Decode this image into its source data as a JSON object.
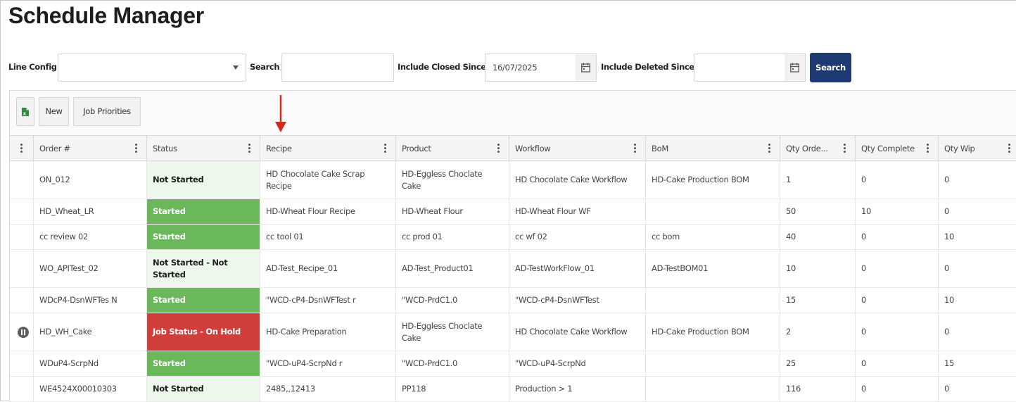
{
  "page": {
    "title": "Schedule Manager"
  },
  "filters": {
    "line_config_label": "Line Config",
    "line_config_value": "",
    "search_label": "Search",
    "search_value": "",
    "closed_since_label": "Include Closed Since",
    "closed_since_value": "16/07/2025",
    "deleted_since_label": "Include Deleted Since",
    "deleted_since_value": "",
    "search_button": "Search"
  },
  "toolbar": {
    "export_icon": "excel-export-icon",
    "new_label": "New",
    "priorities_label": "Job Priorities"
  },
  "columns": [
    "Order #",
    "Status",
    "Recipe",
    "Product",
    "Workflow",
    "BoM",
    "Qty Orde...",
    "Qty Complete",
    "Qty Wip"
  ],
  "rows": [
    {
      "order": "ON_012",
      "status": "Not Started",
      "recipe": "HD Chocolate Cake Scrap Recipe",
      "product": "HD-Eggless Choclate Cake",
      "workflow": "HD Chocolate Cake Workflow",
      "bom": "HD-Cake Production BOM",
      "qty_ordered": "1",
      "qty_complete": "0",
      "qty_wip": "0",
      "status_kind": "not-started",
      "icon": ""
    },
    {
      "order": "HD_Wheat_LR",
      "status": "Started",
      "recipe": "HD-Wheat Flour Recipe",
      "product": "HD-Wheat Flour",
      "workflow": "HD-Wheat Flour WF",
      "bom": "",
      "qty_ordered": "50",
      "qty_complete": "10",
      "qty_wip": "0",
      "status_kind": "started",
      "icon": ""
    },
    {
      "order": "cc review 02",
      "status": "Started",
      "recipe": "cc tool 01",
      "product": "cc prod 01",
      "workflow": "cc wf 02",
      "bom": "cc bom",
      "qty_ordered": "40",
      "qty_complete": "0",
      "qty_wip": "10",
      "status_kind": "started",
      "icon": ""
    },
    {
      "order": "WO_APITest_02",
      "status": "Not Started - Not Started",
      "recipe": "AD-Test_Recipe_01",
      "product": "AD-Test_Product01",
      "workflow": "AD-TestWorkFlow_01",
      "bom": "AD-TestBOM01",
      "qty_ordered": "10",
      "qty_complete": "0",
      "qty_wip": "0",
      "status_kind": "not-started",
      "icon": ""
    },
    {
      "order": "WDcP4-DsnWFTes N",
      "status": "Started",
      "recipe": "\"WCD-cP4-DsnWFTest r",
      "product": "\"WCD-PrdC1.0",
      "workflow": "\"WCD-cP4-DsnWFTest",
      "bom": "",
      "qty_ordered": "15",
      "qty_complete": "0",
      "qty_wip": "10",
      "status_kind": "started",
      "icon": ""
    },
    {
      "order": "HD_WH_Cake",
      "status": "Job Status - On Hold",
      "recipe": "HD-Cake Preparation",
      "product": "HD-Eggless Choclate Cake",
      "workflow": "HD Chocolate Cake Workflow",
      "bom": "HD-Cake Production BOM",
      "qty_ordered": "2",
      "qty_complete": "0",
      "qty_wip": "0",
      "status_kind": "on-hold",
      "icon": "pause-icon"
    },
    {
      "order": "WDuP4-ScrpNd",
      "status": "Started",
      "recipe": "\"WCD-uP4-ScrpNd r",
      "product": "\"WCD-PrdC1.0",
      "workflow": "\"WCD-uP4-ScrpNd",
      "bom": "",
      "qty_ordered": "25",
      "qty_complete": "0",
      "qty_wip": "15",
      "status_kind": "started",
      "icon": ""
    },
    {
      "order": "WE4524X00010303",
      "status": "Not Started",
      "recipe": "2485,,12413",
      "product": "PP118",
      "workflow": "Production > 1",
      "bom": "",
      "qty_ordered": "116",
      "qty_complete": "0",
      "qty_wip": "0",
      "status_kind": "not-started",
      "icon": ""
    }
  ],
  "colors": {
    "primary_button": "#1e3a74",
    "started": "#6bb85a",
    "on_hold": "#d13e3a",
    "not_started": "#eef7ec",
    "annotation_arrow": "#d9261c"
  }
}
